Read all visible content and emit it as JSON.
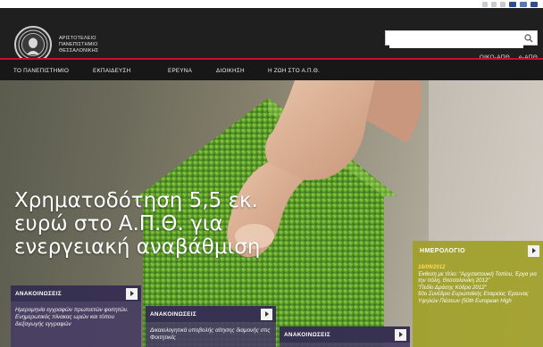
{
  "header": {
    "university_name": [
      "ΑΡΙΣΤΟΤΕΛΕΙΟ",
      "ΠΑΝΕΠΙΣΤΗΜΙΟ",
      "ΘΕΣΣΑΛΟΝΙΚΗΣ"
    ],
    "search": {
      "placeholder": "",
      "value": ""
    },
    "links": [
      "ΟΙΚΟ-ΑΠΘ",
      "e-ΑΠΘ"
    ]
  },
  "nav": {
    "items": [
      "ΤΟ ΠΑΝΕΠΙΣΤΗΜΙΟ",
      "ΕΚΠΑΙΔΕΥΣΗ",
      "ΕΡΕΥΝΑ",
      "ΔΙΟΙΚΗΣΗ",
      "Η ΖΩΗ ΣΤΟ Α.Π.Θ."
    ]
  },
  "hero": {
    "headline": "Χρηματοδότηση 5,5 εκ. ευρώ στο Α.Π.Θ. για ενεργειακή αναβάθμιση"
  },
  "announcements": [
    {
      "title": "ΑΝΑΚΟΙΝΩΣΕΙΣ",
      "text": "Ημερομηνία εγγραφών πρωτοετών φοιτητών. Ενημερωτικός πίνακας ωρών και τόπου διεξαγωγής εγγραφών"
    },
    {
      "title": "ΑΝΑΚΟΙΝΩΣΕΙΣ",
      "text": "Δικαιολογητικά υποβολής αίτησης διαμονής στις Φοιτητικές"
    },
    {
      "title": "ΑΝΑΚΟΙΝΩΣΕΙΣ",
      "text": ""
    }
  ],
  "calendar": {
    "title": "ΗΜΕΡΟΛΟΓΙΟ",
    "date": "18/09/2012",
    "entries": [
      "Έκθεση με τίτλο: \"Αρχιτεκτονική Τοπίου, Έργα για την πόλη, Θεσσαλονίκη 2012\"",
      "\"Πεδίο Δράσης Κόδρα 2012\"",
      "50ο Συνέδριο Ευρωπαϊκής Εταιρείας Έρευνας Υψηλών Πιέσεων (50th European High"
    ]
  },
  "colors": {
    "accent_red": "#c8102e",
    "calendar": "#a0a028",
    "announcement": "#463c64"
  }
}
